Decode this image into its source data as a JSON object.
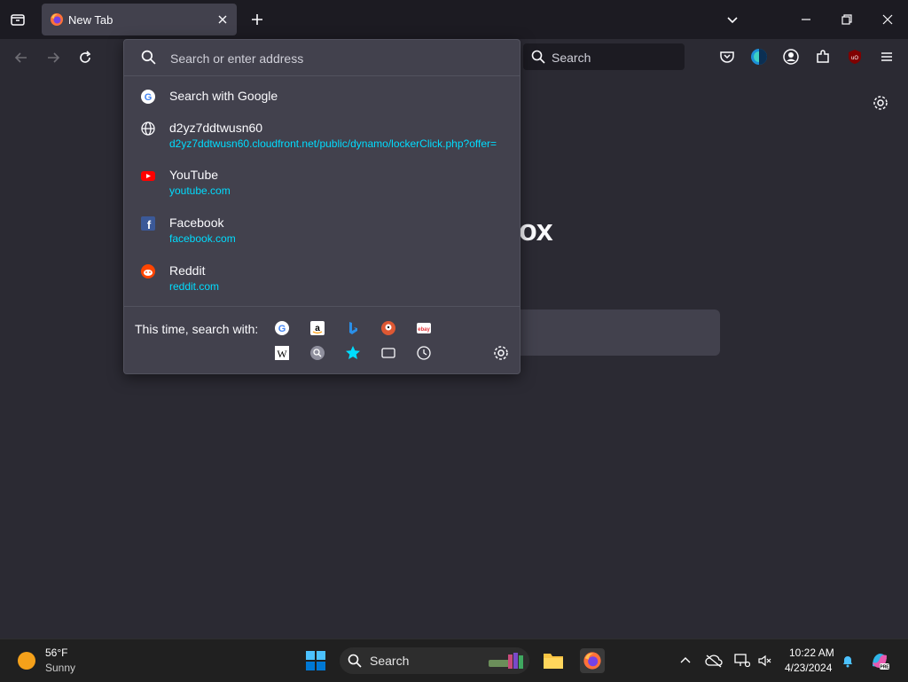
{
  "browser": {
    "tab_title": "New Tab",
    "search_label": "Search",
    "brand_word_fragment": "ox"
  },
  "urlbar": {
    "placeholder": "Search or enter address"
  },
  "results": [
    {
      "title": "Search with Google",
      "url": "",
      "icon": "google-icon"
    },
    {
      "title": "d2yz7ddtwusn60",
      "url": "d2yz7ddtwusn60.cloudfront.net/public/dynamo/lockerClick.php?offer=",
      "icon": "globe-icon"
    },
    {
      "title": "YouTube",
      "url": "youtube.com",
      "icon": "youtube-icon"
    },
    {
      "title": "Facebook",
      "url": "facebook.com",
      "icon": "facebook-icon"
    },
    {
      "title": "Reddit",
      "url": "reddit.com",
      "icon": "reddit-icon"
    }
  ],
  "oneoff": {
    "label": "This time, search with:",
    "engines": [
      "google-icon",
      "amazon-icon",
      "bing-icon",
      "duckduckgo-icon",
      "ebay-icon",
      "wikipedia-icon",
      "search-engine-icon",
      "bookmarks-star-icon",
      "tabs-icon",
      "history-icon",
      "settings-gear-icon"
    ]
  },
  "taskbar": {
    "weather_temp": "56°F",
    "weather_desc": "Sunny",
    "search_label": "Search",
    "time": "10:22 AM",
    "date": "4/23/2024"
  },
  "colors": {
    "accent_link": "#00ddff",
    "popup_bg": "#42414d",
    "toolbar_bg": "#2b2a33",
    "titlebar_bg": "#1c1b22"
  }
}
